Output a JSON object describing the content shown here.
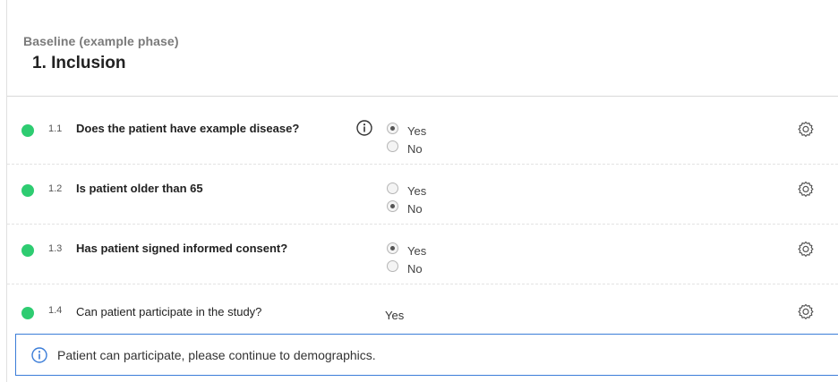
{
  "phase": {
    "label": "Baseline (example phase)"
  },
  "section": {
    "title": "1. Inclusion"
  },
  "questions": [
    {
      "number": "1.1",
      "text": "Does the patient have example disease?",
      "has_info": true,
      "options": [
        {
          "label": "Yes",
          "selected": true
        },
        {
          "label": "No",
          "selected": false
        }
      ]
    },
    {
      "number": "1.2",
      "text": "Is patient older than 65",
      "has_info": false,
      "options": [
        {
          "label": "Yes",
          "selected": false
        },
        {
          "label": "No",
          "selected": true
        }
      ]
    },
    {
      "number": "1.3",
      "text": "Has patient signed informed consent?",
      "has_info": false,
      "options": [
        {
          "label": "Yes",
          "selected": true
        },
        {
          "label": "No",
          "selected": false
        }
      ]
    },
    {
      "number": "1.4",
      "text": "Can patient participate in the study?",
      "has_info": false,
      "computed_value": "Yes"
    }
  ],
  "notice": {
    "text": "Patient can participate, please continue to demographics."
  },
  "colors": {
    "status_complete": "#2ecc71",
    "notice_border": "#3b7dd8"
  },
  "icons": {
    "status": "status-dot-icon",
    "info": "info-icon",
    "settings": "gear-icon"
  }
}
